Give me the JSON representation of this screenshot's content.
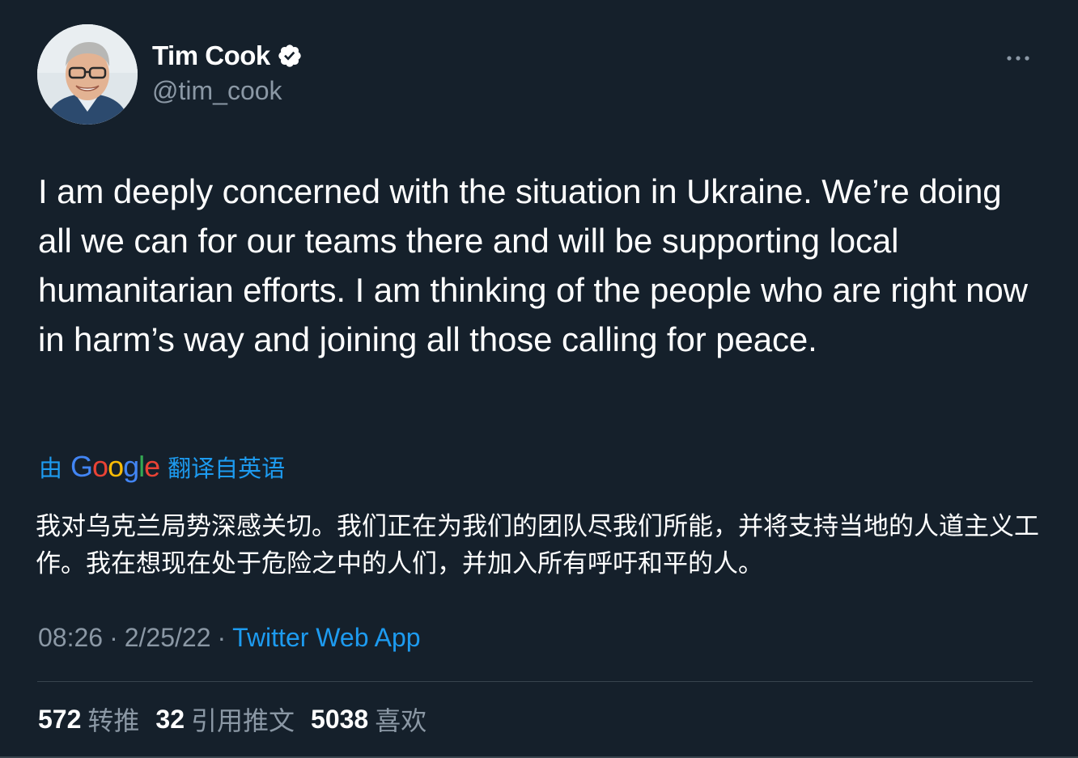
{
  "author": {
    "display_name": "Tim Cook",
    "handle": "@tim_cook",
    "verified": true
  },
  "icons": {
    "verified": "verified-badge-icon",
    "more": "more-horizontal-icon",
    "avatar": "profile-photo"
  },
  "tweet": {
    "text": "I am deeply concerned with the situation in Ukraine. We’re doing all we can for our teams there and will be supporting local humanitarian efforts. I am thinking of the people who are right now in harm’s way and joining all those calling for peace."
  },
  "translation": {
    "prefix": "由",
    "provider": "Google",
    "suffix": "翻译自英语",
    "text": "我对乌克兰局势深感关切。我们正在为我们的团队尽我们所能，并将支持当地的人道主义工作。我在想现在处于危险之中的人们，并加入所有呼吁和平的人。"
  },
  "meta": {
    "time": "08:26",
    "separator": "·",
    "date": "2/25/22",
    "source": "Twitter Web App"
  },
  "stats": [
    {
      "count": "572",
      "label": "转推"
    },
    {
      "count": "32",
      "label": "引用推文"
    },
    {
      "count": "5038",
      "label": "喜欢"
    }
  ],
  "colors": {
    "background": "#15202b",
    "accent": "#1d9bf0",
    "secondary_text": "#8b98a5",
    "divider": "#38444d"
  }
}
